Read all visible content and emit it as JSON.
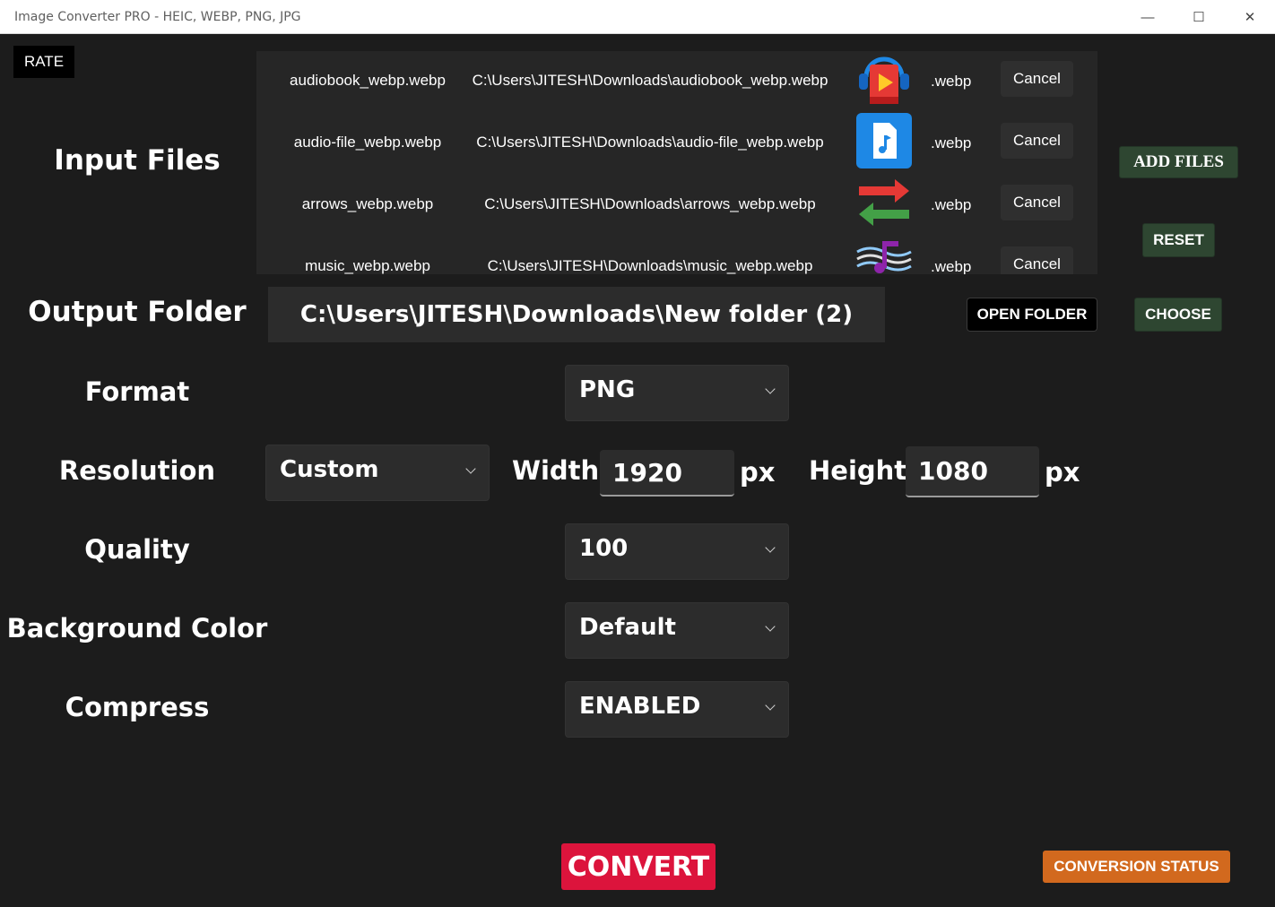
{
  "window": {
    "title": "Image Converter PRO - HEIC, WEBP, PNG, JPG",
    "minimize_glyph": "—",
    "maximize_glyph": "☐",
    "close_glyph": "✕"
  },
  "rate_label": "RATE",
  "input_files": {
    "label": "Input Files",
    "files": [
      {
        "name": "audiobook_webp.webp",
        "path": "C:\\Users\\JITESH\\Downloads\\audiobook_webp.webp",
        "icon": "audiobook-icon",
        "ext": ".webp",
        "cancel": "Cancel"
      },
      {
        "name": "audio-file_webp.webp",
        "path": "C:\\Users\\JITESH\\Downloads\\audio-file_webp.webp",
        "icon": "audio-file-icon",
        "ext": ".webp",
        "cancel": "Cancel"
      },
      {
        "name": "arrows_webp.webp",
        "path": "C:\\Users\\JITESH\\Downloads\\arrows_webp.webp",
        "icon": "arrows-icon",
        "ext": ".webp",
        "cancel": "Cancel"
      },
      {
        "name": "music_webp.webp",
        "path": "C:\\Users\\JITESH\\Downloads\\music_webp.webp",
        "icon": "music-icon",
        "ext": ".webp",
        "cancel": "Cancel"
      }
    ],
    "add_files": "ADD FILES",
    "reset": "RESET"
  },
  "output_folder": {
    "label": "Output Folder",
    "path": "C:\\Users\\JITESH\\Downloads\\New folder (2)",
    "open_folder": "OPEN FOLDER",
    "choose": "CHOOSE"
  },
  "format": {
    "label": "Format",
    "value": "PNG"
  },
  "resolution": {
    "label": "Resolution",
    "value": "Custom",
    "width_label": "Width",
    "width": "1920",
    "height_label": "Height",
    "height": "1080",
    "unit": "px"
  },
  "quality": {
    "label": "Quality",
    "value": "100"
  },
  "background_color": {
    "label": "Background Color",
    "value": "Default"
  },
  "compress": {
    "label": "Compress",
    "value": "ENABLED"
  },
  "convert": "CONVERT",
  "conversion_status": "CONVERSION STATUS",
  "colors": {
    "background": "#1c1c1c",
    "green_button": "#2e4631",
    "convert": "#dc143c",
    "status": "#d2691e"
  }
}
